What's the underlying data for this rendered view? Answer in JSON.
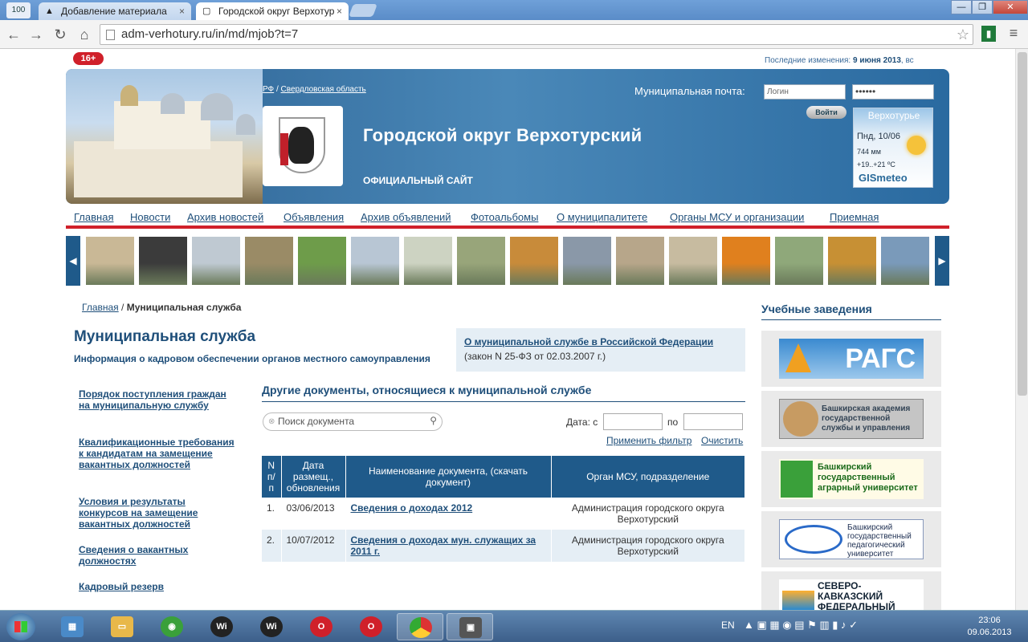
{
  "browser": {
    "app_icon_text": "100",
    "tabs": [
      {
        "title": "Добавление материала",
        "close": "×"
      },
      {
        "title": "Городской округ Верхотур",
        "close": "×"
      }
    ],
    "window_buttons": {
      "minimize": "—",
      "restore": "❐",
      "close": "✕"
    },
    "url": "adm-verhotury.ru/in/md/mjob?t=7"
  },
  "top": {
    "age_badge": "16+",
    "last_changes_label": "Последние изменения:",
    "last_changes_date": "9 июня 2013",
    "last_changes_suffix": ", вс"
  },
  "header": {
    "crumb_rf": "РФ",
    "crumb_sep": " / ",
    "crumb_region": "Свердловская область",
    "site_title": "Городской округ Верхотурский",
    "site_subtitle": "ОФИЦИАЛЬНЫЙ САЙТ",
    "mail_label": "Муниципальная почта:",
    "login_placeholder": "Логин",
    "password_value": "••••••",
    "login_button": "Войти"
  },
  "weather": {
    "city": "Верхотурье",
    "day": "Пнд, 10/06",
    "pressure": "744 мм",
    "temp": "+19..+21 ºС",
    "brand": "GISmeteo"
  },
  "nav": [
    "Главная",
    "Новости",
    "Архив новостей",
    "Объявления",
    "Архив объявлений",
    "Фотоальбомы",
    "О муниципалитете",
    "Органы МСУ и организации",
    "Приемная"
  ],
  "gallery": {
    "prev": "◀",
    "next": "▶",
    "thumb_colors": [
      "#c9b896",
      "#3b3b3b",
      "#bfc9d2",
      "#9a8b66",
      "#6e9c4a",
      "#b8c6d4",
      "#cdd3c2",
      "#98a57a",
      "#c88b3a",
      "#8a98a8",
      "#b7a68a",
      "#c7bba0",
      "#e0801e",
      "#8fa87a",
      "#c79034",
      "#7a9aba"
    ]
  },
  "main": {
    "breadcrumb_home": "Главная",
    "breadcrumb_sep": " / ",
    "breadcrumb_current": "Муниципальная служба",
    "title": "Муниципальная служба",
    "subtitle": "Информация о кадровом обеспечении органов местного самоуправления",
    "fed_link": "О муниципальной службе в Российской Федерации",
    "fed_note": "(закон N 25-ФЗ от 02.03.2007 г.)",
    "left_links": [
      "Порядок поступления граждан на муниципальную службу",
      "Квалификационные требования к кандидатам на замещение вакантных должностей",
      "Условия и результаты конкурсов на замещение вакантных должностей",
      "Сведения о вакантных должностях",
      "Кадровый резерв"
    ],
    "other_docs_title": "Другие документы, относящиеся к муниципальной службе",
    "search_placeholder": "Поиск документа",
    "date_label": "Дата: с",
    "date_to_label": "по",
    "apply_filter": "Применить фильтр",
    "clear_filter": "Очистить",
    "table": {
      "headers": [
        "N п/ п",
        "Дата размещ., обновления",
        "Наименование документа, (скачать документ)",
        "Орган МСУ, подразделение"
      ],
      "rows": [
        {
          "num": "1.",
          "date": "03/06/2013",
          "name": "Сведения о доходах 2012",
          "org": "Администрация городского округа Верхотурский"
        },
        {
          "num": "2.",
          "date": "10/07/2012",
          "name": "Сведения о доходах мун. служащих за 2011 г.",
          "org": "Администрация городского округа Верхотурский"
        }
      ]
    }
  },
  "right": {
    "title": "Учебные заведения",
    "rags": "РАГС",
    "bash_academy": "Башкирская академия государственной службы и управления",
    "bash_agro": "Башкирский государственный аграрный университет",
    "bash_ped": "Башкирский государственный педагогический университет",
    "skfu": "СЕВЕРО-КАВКАЗСКИЙ ФЕДЕРАЛЬНЫЙ"
  },
  "taskbar": {
    "lang": "EN",
    "time": "23:06",
    "date": "09.06.2013",
    "tray_arrow": "▲"
  }
}
